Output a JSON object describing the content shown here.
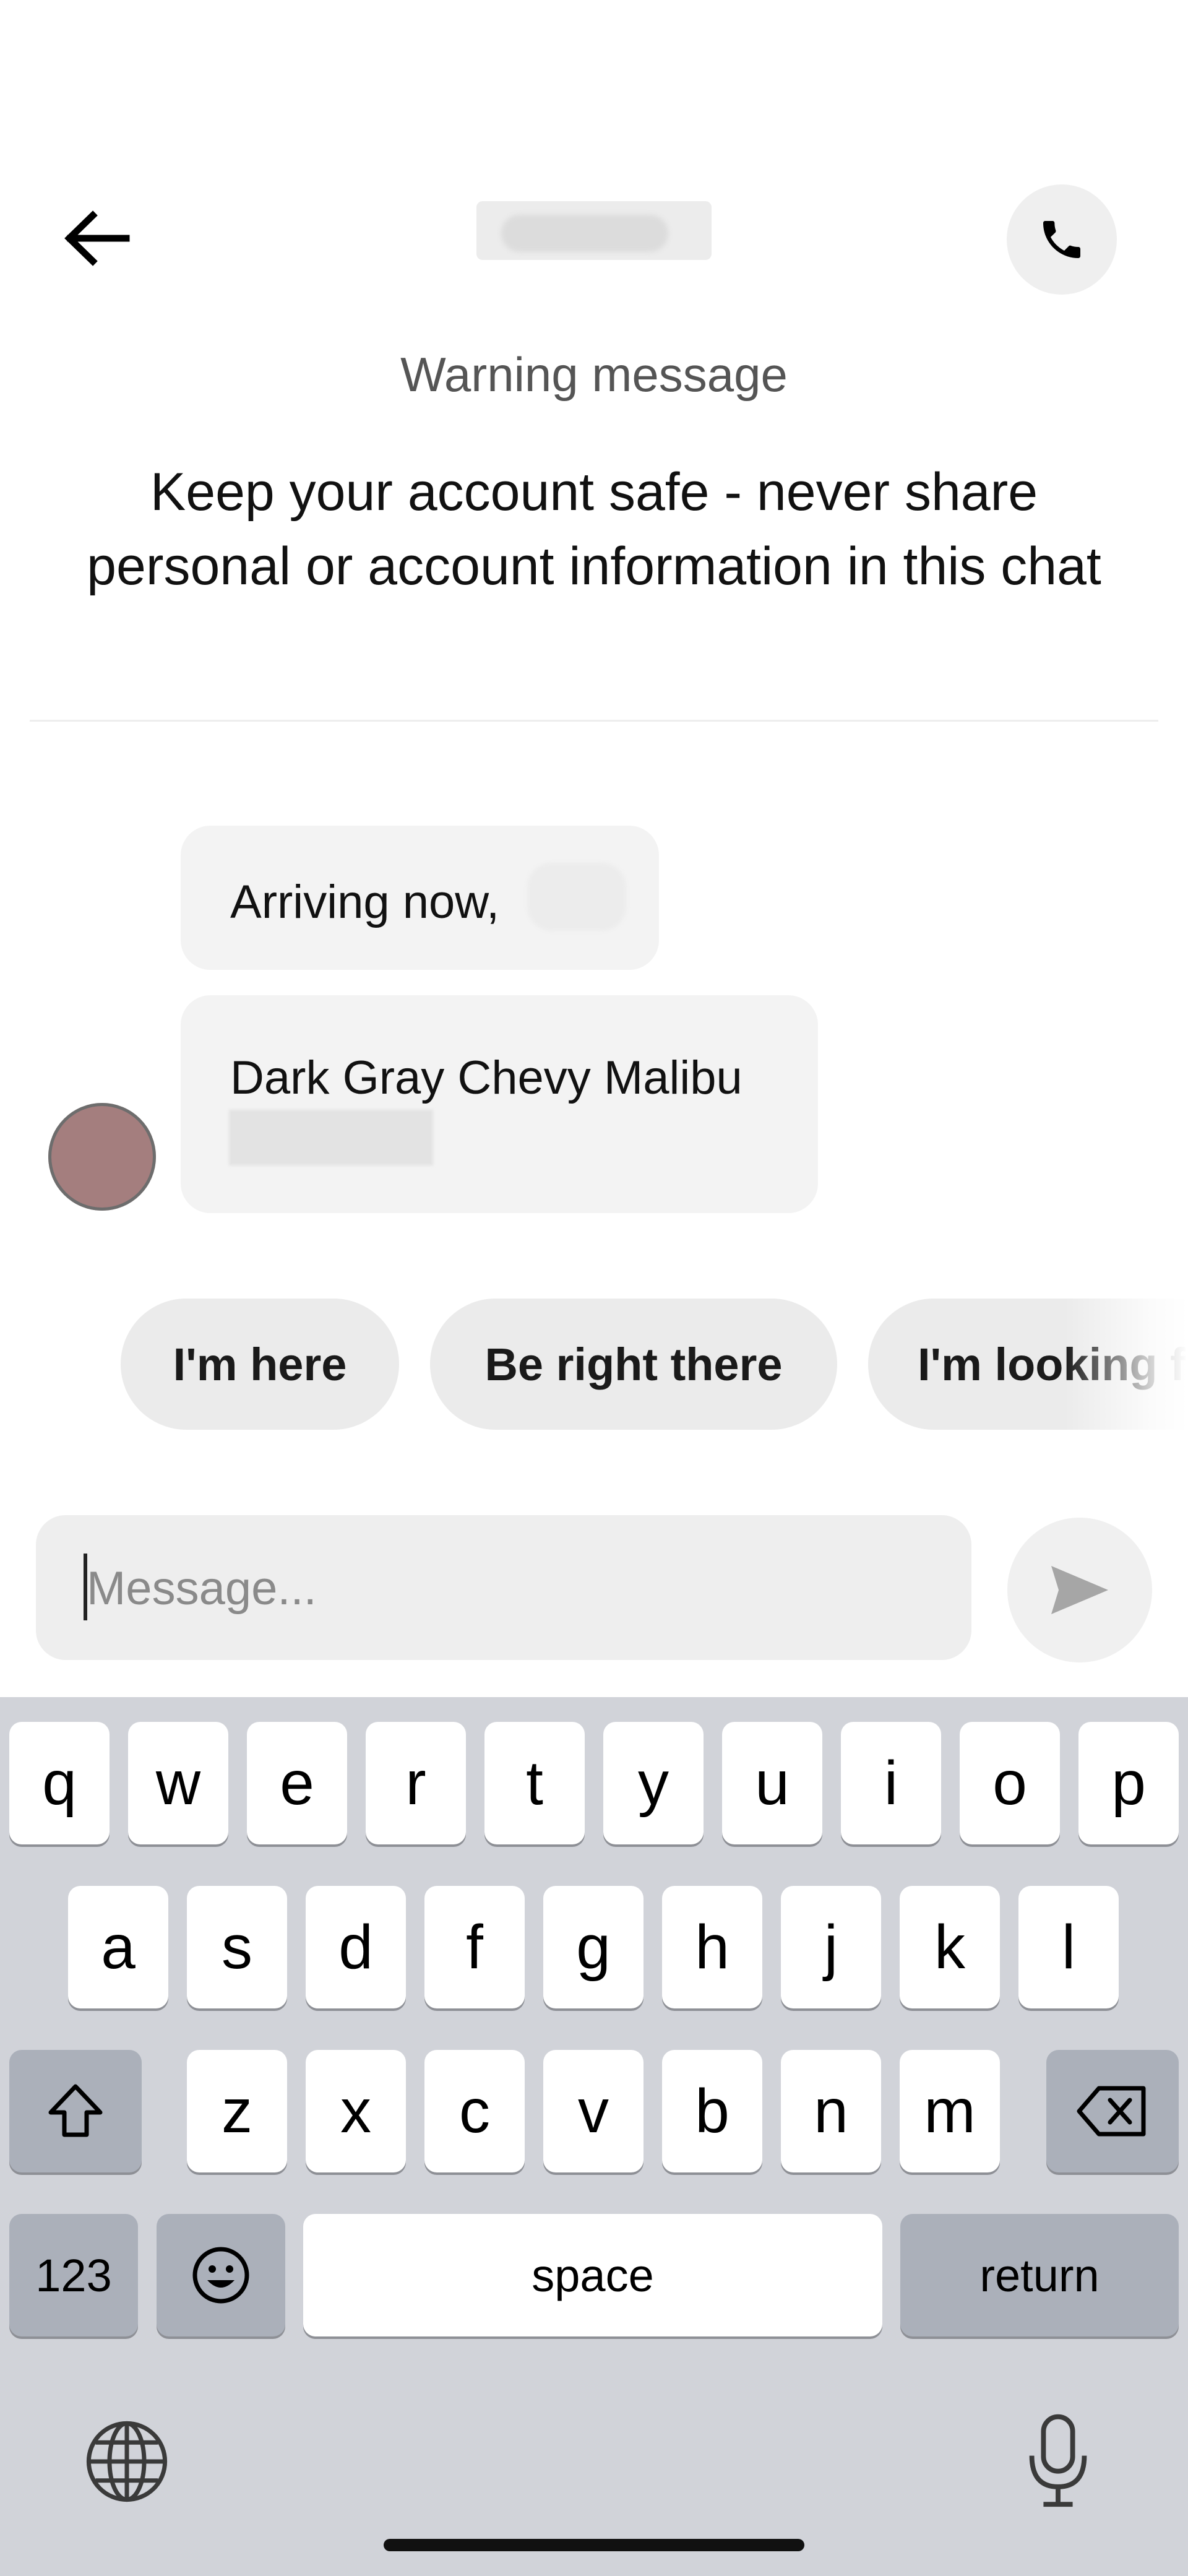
{
  "header": {
    "back_icon": "arrow-left-icon",
    "call_icon": "phone-icon"
  },
  "warning": {
    "title": "Warning message",
    "body": "Keep your account safe - never share personal or account information in this chat"
  },
  "messages": [
    {
      "text": "Arriving now,"
    },
    {
      "text": "Dark Gray Chevy Malibu"
    }
  ],
  "quick_replies": [
    "I'm here",
    "Be right there",
    "I'm looking f"
  ],
  "composer": {
    "placeholder": "Message...",
    "send_icon": "send-icon"
  },
  "keyboard": {
    "row1": [
      "q",
      "w",
      "e",
      "r",
      "t",
      "y",
      "u",
      "i",
      "o",
      "p"
    ],
    "row2": [
      "a",
      "s",
      "d",
      "f",
      "g",
      "h",
      "j",
      "k",
      "l"
    ],
    "row3": [
      "z",
      "x",
      "c",
      "v",
      "b",
      "n",
      "m"
    ],
    "numbers_label": "123",
    "space_label": "space",
    "return_label": "return"
  },
  "colors": {
    "background": "#ffffff",
    "bubble": "#f3f3f3",
    "chip": "#ebebeb",
    "keyboard_bg": "#d1d3d9",
    "key_dark": "#abb0ba"
  }
}
